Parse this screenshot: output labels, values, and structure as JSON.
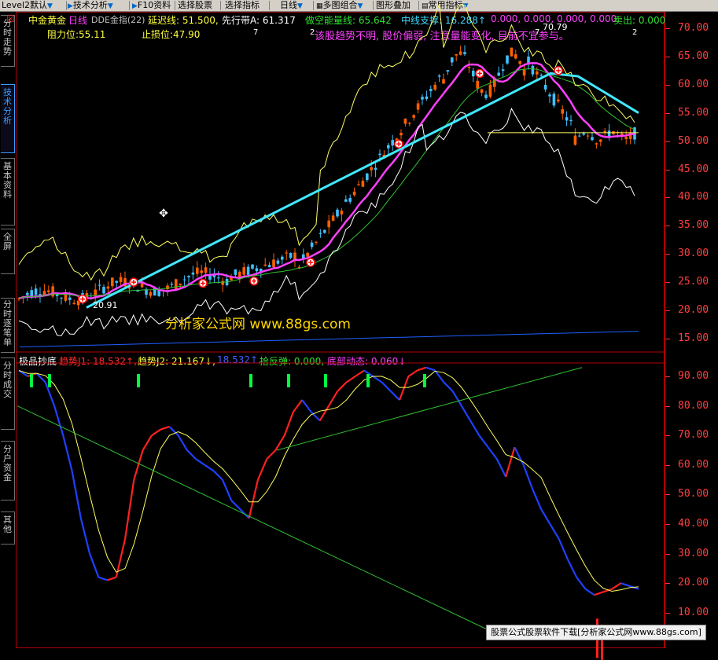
{
  "toolbar": {
    "items": [
      {
        "label": "Level2默认",
        "arrow": "▼"
      },
      {
        "label": "技术分析",
        "arrow": "▼"
      },
      {
        "label": "F10资料",
        "arrow": ""
      },
      {
        "label": "选择股票",
        "arrow": ""
      },
      {
        "label": "选择指标",
        "arrow": ""
      },
      {
        "label": "日线",
        "arrow": "▼"
      },
      {
        "label": "多图组合",
        "arrow": "▼"
      },
      {
        "label": "图形叠加",
        "arrow": ""
      },
      {
        "label": "常用指标",
        "arrow": "▼"
      }
    ]
  },
  "sidetabs": [
    {
      "label": "分时走势",
      "active": false
    },
    {
      "label": "技术分析",
      "active": true
    },
    {
      "label": "基本资料",
      "active": false
    },
    {
      "label": "全屏",
      "active": false
    },
    {
      "label": "分时逐笔单",
      "active": false
    },
    {
      "label": "分时成交",
      "active": false
    },
    {
      "label": "分户资金",
      "active": false
    },
    {
      "label": "其他",
      "active": false
    }
  ],
  "main_header": {
    "stock_name": "中金黄金",
    "period": "日线",
    "indicator": "DDE金指(22)",
    "delay_line": "延迟线: 51.500,",
    "lead_band": "先行带A: 61.317",
    "bull_bear": "做空能量线: 65.642",
    "mid_support": "中线支撑: 16.288↑",
    "zeros": "0.000, 0.000, 0.000, 0.000,",
    "sell": "卖出: 0.000",
    "resistance": "阻力位:55.11",
    "stop_loss": "止损位:47.90",
    "warning": "该股趋势不明, 股价偏弱, 注意量能变化, 目前不宜参与。",
    "mark_7a": "7",
    "mark_7b": "7",
    "mark_2a": "2",
    "mark_2b": "2",
    "peak_label": "70.79",
    "low_label": "20.91"
  },
  "sub_header": {
    "name": "极品抄底",
    "trend1": "趋势J1: 18.532↑,",
    "trend2": "趋势J2: 21.167↓,",
    "trend3": "18.532↑,",
    "rebound": "拾反弹: 0.000,",
    "bottom": "底部动态: 0.060↓"
  },
  "price_axis": [
    "70.00",
    "65.00",
    "60.00",
    "55.00",
    "50.00",
    "45.00",
    "40.00",
    "35.00",
    "30.00",
    "25.00",
    "20.00",
    "15.00"
  ],
  "sub_axis": [
    "90.00",
    "80.00",
    "70.00",
    "60.00",
    "50.00",
    "40.00",
    "30.00",
    "20.00",
    "10.00"
  ],
  "watermark": "分析家公式网 www.88gs.com",
  "footer_banner": "股票公式股票软件下载[分析家公式网www.88gs.com]",
  "colors": {
    "axis": "#ff3030",
    "up_candle": "#ff6000",
    "down_candle": "#40c0ff",
    "line_cyan": "#40e8ff",
    "line_magenta": "#ff40ff",
    "line_yellow": "#ffff60",
    "line_green": "#30c030",
    "line_white": "#ffffff",
    "osc_red": "#ff2020",
    "osc_blue": "#2040ff",
    "signal_green": "#00ff40"
  },
  "chart_data": [
    {
      "type": "line",
      "title": "中金黄金 日线",
      "ylim": [
        13,
        73
      ],
      "series": [
        {
          "name": "延迟线",
          "values": [
            51.5
          ]
        },
        {
          "name": "先行带A",
          "values": [
            61.317
          ]
        },
        {
          "name": "做空能量线",
          "values": [
            65.642
          ]
        },
        {
          "name": "中线支撑",
          "values": [
            16.288
          ]
        }
      ],
      "resistance": 55.11,
      "stop_loss": 47.9,
      "high_annotation": 70.79,
      "low_annotation": 20.91
    },
    {
      "type": "line",
      "title": "极品抄底",
      "ylim": [
        2,
        97
      ],
      "series": [
        {
          "name": "趋势J1",
          "values": [
            18.532
          ]
        },
        {
          "name": "趋势J2",
          "values": [
            21.167
          ]
        },
        {
          "name": "拾反弹",
          "values": [
            0.0
          ]
        },
        {
          "name": "底部动态",
          "values": [
            0.06
          ]
        }
      ]
    }
  ]
}
